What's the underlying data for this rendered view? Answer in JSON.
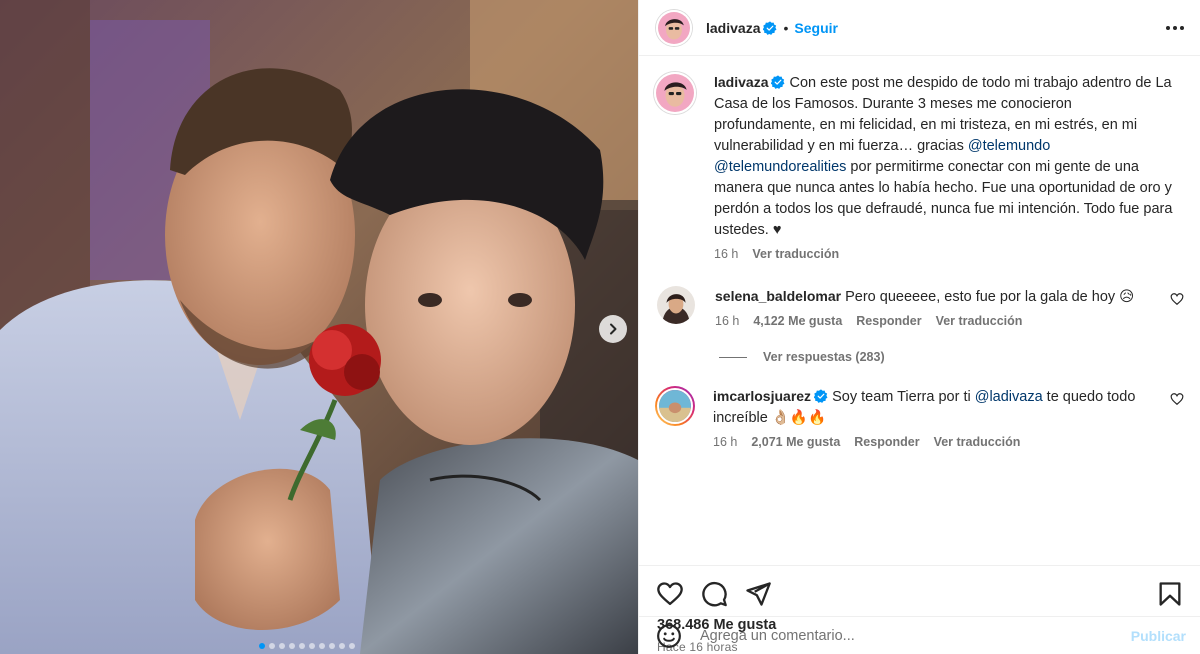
{
  "post": {
    "username": "ladivaza",
    "follow_label": "Seguir",
    "bullet": "•",
    "caption": {
      "username": "ladivaza",
      "text_1": "Con este post me despido de todo mi trabajo adentro de La Casa de los Famosos. Durante 3 meses me conocieron profundamente, en mi felicidad, en mi tristeza, en mi estrés, en mi vulnerabilidad y en mi fuerza… gracias ",
      "mention_1": "@telemundo",
      "mention_2": "@telemundorealities",
      "text_2": " por permitirme conectar con mi gente de una manera que nunca antes lo había hecho. Fue una oportunidad de oro y perdón a todos los que defraudé, nunca fue mi intención. Todo fue para ustedes. ♥",
      "time": "16 h",
      "translate": "Ver traducción"
    }
  },
  "comments": [
    {
      "username": "selena_baldelomar",
      "text": "Pero queeeee, esto fue por la gala de hoy 😥",
      "time": "16 h",
      "likes": "4,122 Me gusta",
      "reply": "Responder",
      "translate": "Ver traducción",
      "replies": "Ver respuestas (283)"
    },
    {
      "username": "imcarlosjuarez",
      "text_1": "Soy team Tierra por ti ",
      "mention": "@ladivaza",
      "text_2": " te quedo todo increíble 👌🏼🔥🔥",
      "time": "16 h",
      "likes": "2,071 Me gusta",
      "reply": "Responder",
      "translate": "Ver traducción"
    }
  ],
  "footer": {
    "likes": "368.486 Me gusta",
    "posted": "Hace 16 horas",
    "comment_placeholder": "Agrega un comentario...",
    "publish_label": "Publicar"
  },
  "carousel": {
    "total_slides": 10,
    "active_slide": 1
  },
  "colors": {
    "accent": "#0095f6",
    "mention": "#00376b",
    "muted": "#737373"
  },
  "icons": [
    "verified-badge-icon",
    "more-options-icon",
    "heart-icon",
    "comment-icon",
    "share-icon",
    "bookmark-icon",
    "emoji-icon",
    "chevron-right-icon"
  ]
}
